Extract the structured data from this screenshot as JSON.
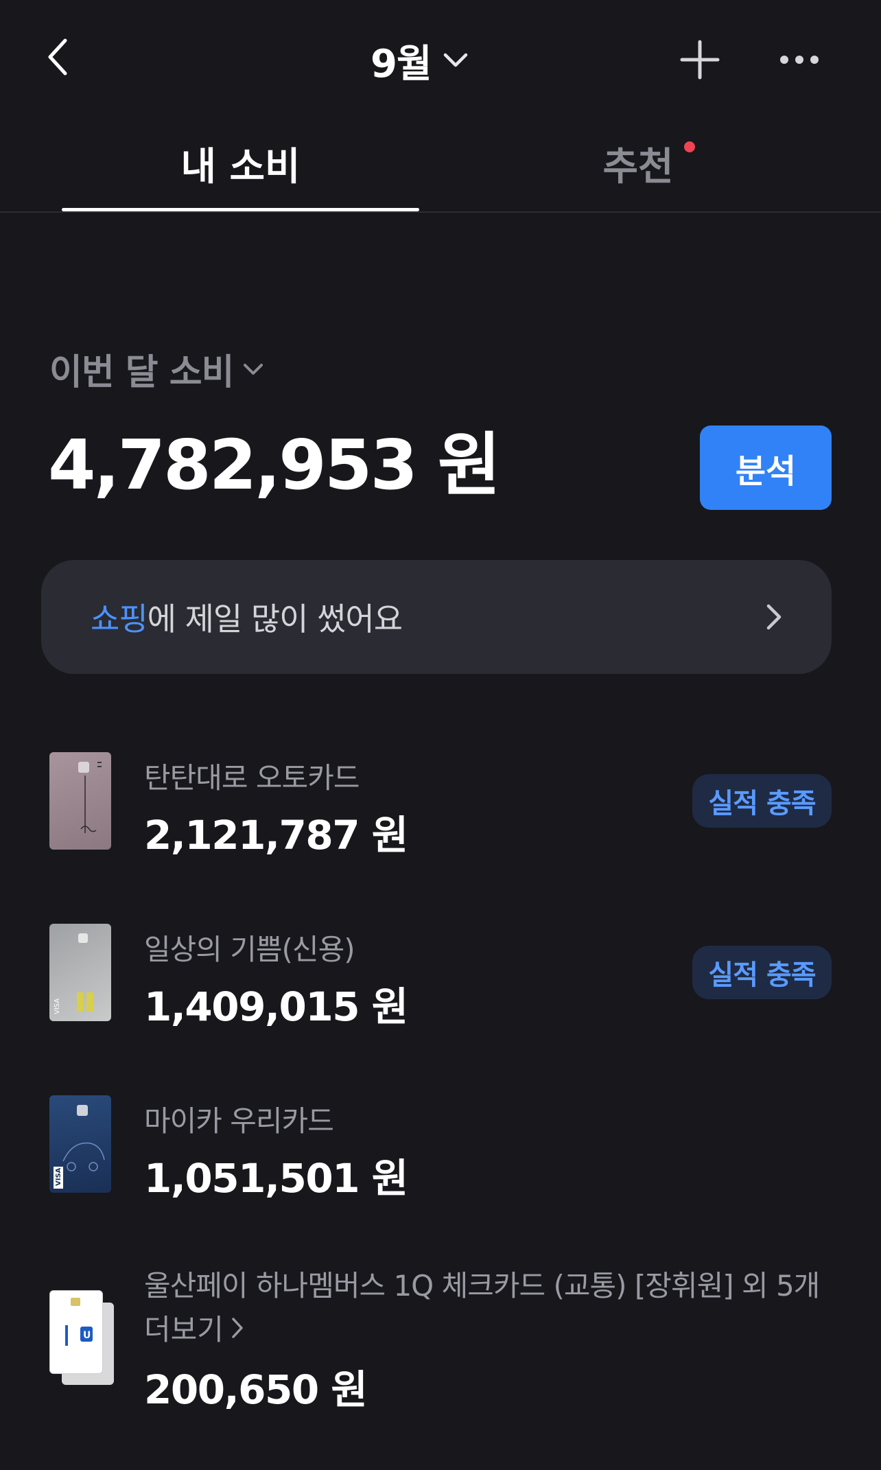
{
  "header": {
    "month_label": "9월"
  },
  "tabs": [
    {
      "label": "내 소비",
      "active": true
    },
    {
      "label": "추천",
      "active": false,
      "has_dot": true
    }
  ],
  "summary": {
    "label": "이번 달 소비",
    "total": "4,782,953 원",
    "analysis_button": "분석"
  },
  "insight": {
    "highlight": "쇼핑",
    "text": "에 제일 많이 썼어요"
  },
  "cards": [
    {
      "name": "탄탄대로 오토카드",
      "amount": "2,121,787 원",
      "badge": "실적 충족"
    },
    {
      "name": "일상의 기쁨(신용)",
      "amount": "1,409,015 원",
      "badge": "실적 충족"
    },
    {
      "name": "마이카 우리카드",
      "amount": "1,051,501 원"
    },
    {
      "name": "울산페이 하나멤버스 1Q 체크카드 (교통) [장휘원] 외 5개",
      "more_label": "더보기",
      "amount": "200,650 원"
    }
  ],
  "colors": {
    "background": "#17171c",
    "accent_blue": "#3182f6",
    "notification_dot": "#f04452",
    "badge_text": "#5a9bff"
  },
  "icons": {
    "back": "chevron-left-icon",
    "month_dropdown": "chevron-down-icon",
    "add": "plus-icon",
    "more": "more-horizontal-icon",
    "insight": "chevron-right-icon"
  }
}
